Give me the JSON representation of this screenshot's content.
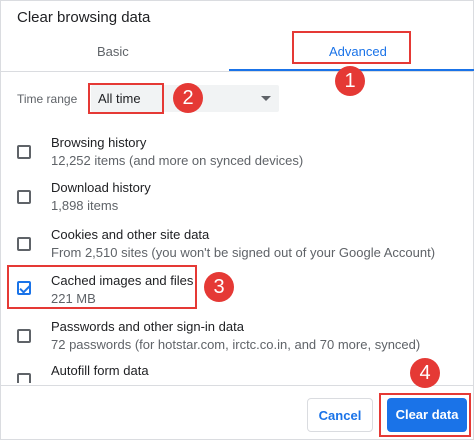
{
  "dialog": {
    "title": "Clear browsing data",
    "tabs": [
      {
        "label": "Basic"
      },
      {
        "label": "Advanced",
        "active": true
      }
    ],
    "time_range": {
      "label": "Time range",
      "selected": "All time"
    },
    "items": [
      {
        "title": "Browsing history",
        "subtitle": "12,252 items (and more on synced devices)",
        "checked": false
      },
      {
        "title": "Download history",
        "subtitle": "1,898 items",
        "checked": false
      },
      {
        "title": "Cookies and other site data",
        "subtitle": "From 2,510 sites (you won't be signed out of your Google Account)",
        "checked": false
      },
      {
        "title": "Cached images and files",
        "subtitle": "221 MB",
        "checked": true
      },
      {
        "title": "Passwords and other sign-in data",
        "subtitle": "72 passwords (for hotstar.com, irctc.co.in, and 70 more, synced)",
        "checked": false
      },
      {
        "title": "Autofill form data",
        "subtitle": "",
        "checked": false
      }
    ],
    "buttons": {
      "cancel": "Cancel",
      "clear": "Clear data"
    }
  },
  "annotations": {
    "step1": "1",
    "step2": "2",
    "step3": "3",
    "step4": "4",
    "color": "#e53935"
  },
  "colors": {
    "accent": "#1a73e8",
    "text": "#202124",
    "muted": "#5f6368"
  }
}
